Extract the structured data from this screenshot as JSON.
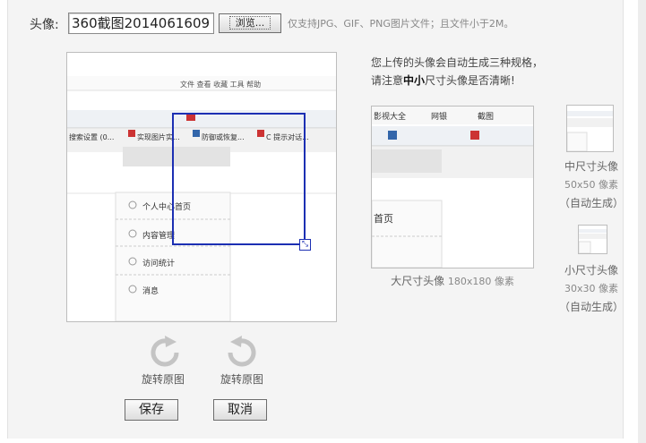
{
  "avatar_label": "头像:",
  "file_input_value": "360截图2014061609",
  "browse_label": "浏览...",
  "hint": "仅支持JPG、GIF、PNG图片文件；且文件小于2M。",
  "info_line1": "您上传的头像会自动生成三种规格，",
  "info_line2_pre": "请注意",
  "info_line2_bold": "中小",
  "info_line2_post": "尺寸头像是否清晰!",
  "large_caption": "大尺寸头像",
  "large_size": "180x180 像素",
  "medium_caption": "中尺寸头像",
  "medium_size": "50x50 像素",
  "medium_auto": "（自动生成）",
  "small_caption": "小尺寸头像",
  "small_size": "30x30 像素",
  "small_auto": "（自动生成）",
  "rotate_left_label": "旋转原图",
  "rotate_right_label": "旋转原图",
  "save_label": "保存",
  "cancel_label": "取消",
  "screenshot_text": {
    "menu": "文件  查看  收藏  工具  帮助",
    "tab1": "搜索设置 (0...",
    "tab2": "实现图片实...",
    "tab3": "防御或恢复...",
    "tab4": "C 提示对话...",
    "side_item1": "个人中心首页",
    "side_item2": "内容管理",
    "side_item3": "访问统计",
    "side_item4": "消息",
    "bar1": "影视大全",
    "bar2": "网银",
    "bar3": "截图",
    "big_item": "首页"
  },
  "colors": {
    "crop_border": "#1c2fb3",
    "panel_bg": "#f4f4f4"
  }
}
